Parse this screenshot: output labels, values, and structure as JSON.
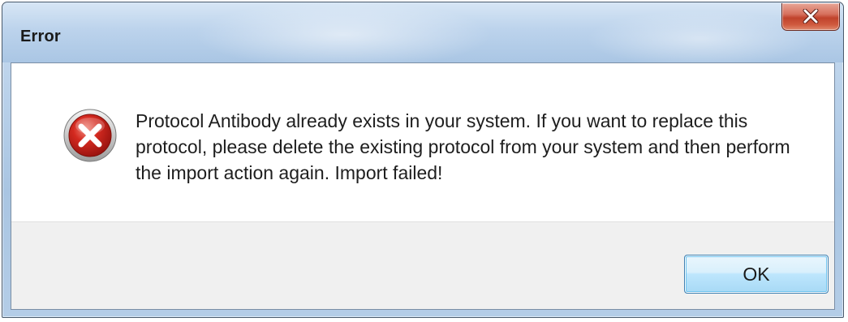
{
  "dialog": {
    "title": "Error",
    "close_icon": "close-icon",
    "message_icon": "error-icon",
    "message": "Protocol Antibody already exists in your system. If you want to replace this protocol, please delete the existing protocol from your system and then perform the import action again. Import failed!",
    "ok_label": "OK"
  },
  "colors": {
    "error_red": "#d42a20",
    "accent_blue": "#3c7fb1"
  }
}
